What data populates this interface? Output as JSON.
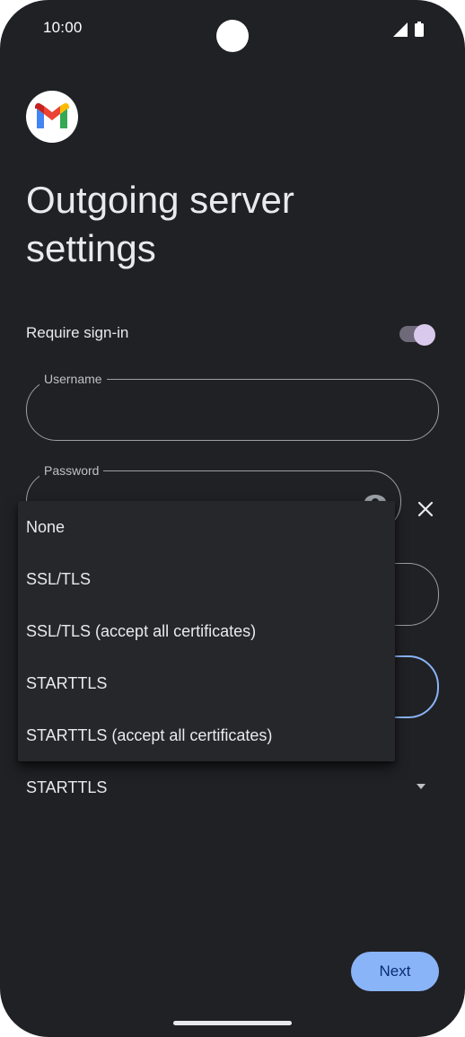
{
  "status_bar": {
    "time": "10:00",
    "icons": [
      "signal-icon",
      "battery-icon"
    ]
  },
  "app": {
    "logo": "gmail-logo",
    "title": "Outgoing server settings"
  },
  "require_signin": {
    "label": "Require sign-in",
    "enabled": true
  },
  "fields": {
    "username": {
      "label": "Username",
      "value": ""
    },
    "password": {
      "label": "Password",
      "value": ""
    }
  },
  "security": {
    "selected": "STARTTLS",
    "options": [
      "None",
      "SSL/TLS",
      "SSL/TLS (accept all certificates)",
      "STARTTLS",
      "STARTTLS (accept all certificates)"
    ]
  },
  "actions": {
    "next_label": "Next"
  },
  "colors": {
    "background": "#202124",
    "accent": "#8ab4f8",
    "toggle_thumb": "#d9c9ec"
  }
}
